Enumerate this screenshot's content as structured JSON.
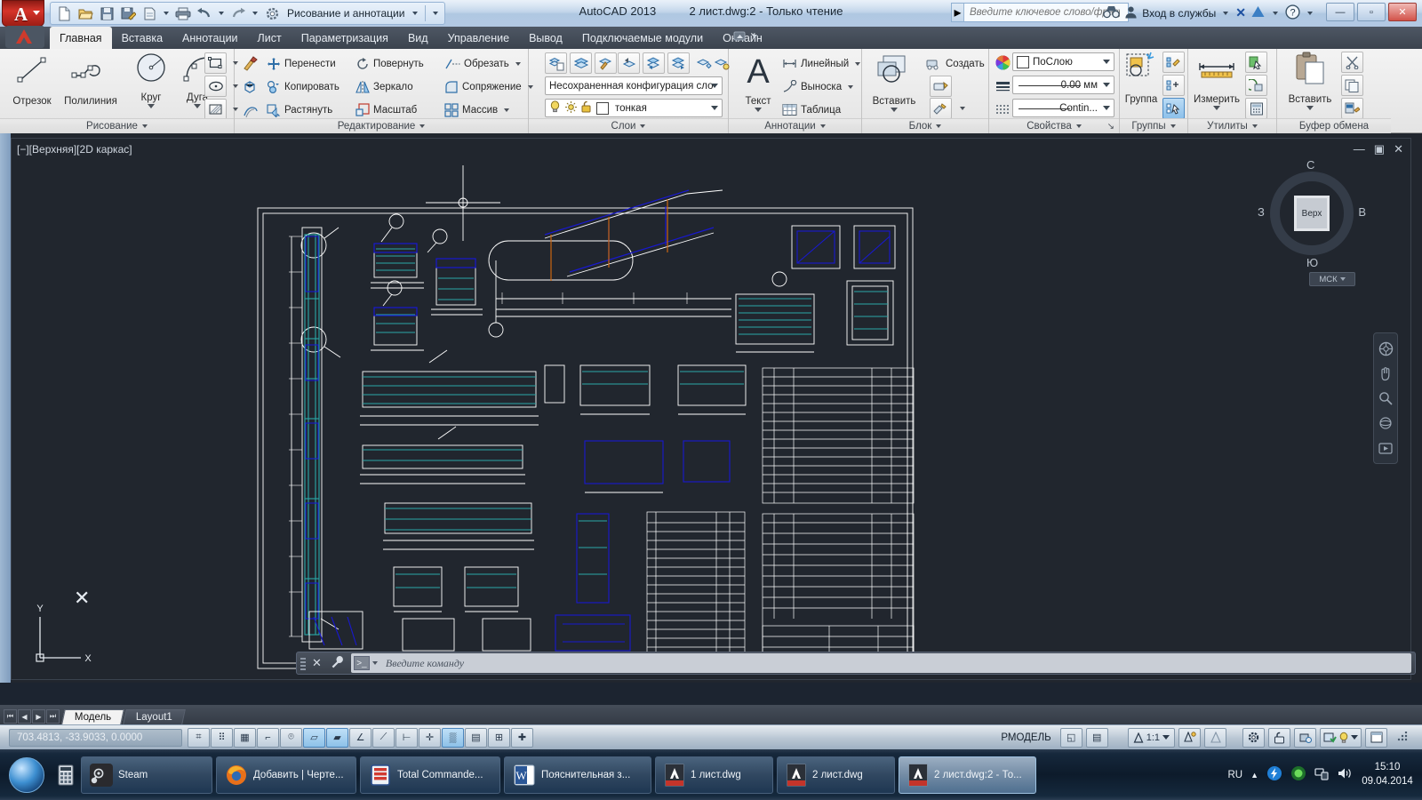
{
  "titlebar": {
    "app_icon": "autocad-logo-icon",
    "quick_access": [
      {
        "name": "new-icon",
        "glyph": "🗋"
      },
      {
        "name": "open-icon",
        "glyph": "🗁"
      },
      {
        "name": "save-icon",
        "glyph": "🖫"
      },
      {
        "name": "save-as-icon",
        "glyph": "🖫"
      },
      {
        "name": "plot-preview-icon",
        "glyph": "🗐"
      },
      {
        "name": "print-icon",
        "glyph": "🖨"
      },
      {
        "name": "undo-icon",
        "glyph": "↶"
      },
      {
        "name": "redo-icon",
        "glyph": "↷"
      }
    ],
    "workspace": "Рисование и аннотации",
    "app_name": "AutoCAD 2013",
    "document": "2 лист.dwg:2 - Только чтение",
    "search_placeholder": "Введите ключевое слово/фразу",
    "signin": "Вход в службы",
    "help_icon": "help-icon",
    "window_buttons": {
      "minimize": "—",
      "maximize": "▫",
      "close": "✕"
    }
  },
  "tabs": [
    {
      "label": "Главная",
      "active": true
    },
    {
      "label": "Вставка",
      "active": false
    },
    {
      "label": "Аннотации",
      "active": false
    },
    {
      "label": "Лист",
      "active": false
    },
    {
      "label": "Параметризация",
      "active": false
    },
    {
      "label": "Вид",
      "active": false
    },
    {
      "label": "Управление",
      "active": false
    },
    {
      "label": "Вывод",
      "active": false
    },
    {
      "label": "Подключаемые модули",
      "active": false
    },
    {
      "label": "Онлайн",
      "active": false
    }
  ],
  "panels": {
    "draw": {
      "title": "Рисование",
      "tools": [
        {
          "label": "Отрезок",
          "icon": "line-icon"
        },
        {
          "label": "Полилиния",
          "icon": "polyline-icon"
        },
        {
          "label": "Круг",
          "icon": "circle-icon",
          "dropdown": true
        },
        {
          "label": "Дуга",
          "icon": "arc-icon",
          "dropdown": true
        }
      ],
      "small_icons": [
        "rectangle-icon",
        "ellipse-icon",
        "hatch-icon"
      ]
    },
    "modify": {
      "title": "Редактирование",
      "items": [
        {
          "label": "Перенести",
          "icon": "move-icon"
        },
        {
          "label": "Повернуть",
          "icon": "rotate-icon"
        },
        {
          "label": "Обрезать",
          "icon": "trim-icon",
          "dropdown": true
        },
        {
          "label": "Копировать",
          "icon": "copy-icon"
        },
        {
          "label": "Зеркало",
          "icon": "mirror-icon"
        },
        {
          "label": "Сопряжение",
          "icon": "fillet-icon",
          "dropdown": true
        },
        {
          "label": "Растянуть",
          "icon": "stretch-icon"
        },
        {
          "label": "Масштаб",
          "icon": "scale-icon"
        },
        {
          "label": "Массив",
          "icon": "array-icon",
          "dropdown": true
        }
      ],
      "side_icons": [
        "match-properties-icon",
        "explode-icon",
        "offset-icon"
      ]
    },
    "layers": {
      "title": "Слои",
      "icons": [
        "layer-properties-icon",
        "layer-state-icon",
        "layer-match-icon",
        "layer-previous-icon",
        "layer-isolate-icon",
        "layer-unisolate-icon",
        "layer-freeze-icon",
        "layer-off-icon"
      ],
      "layer_state": "Несохраненная конфигурация сло",
      "current_layer": "тонкая",
      "layer_toggles": [
        "lightbulb-icon",
        "sun-icon",
        "unlock-icon",
        "color-swatch-icon"
      ]
    },
    "annotation": {
      "title": "Аннотации",
      "big": {
        "label": "Текст",
        "icon": "text-icon",
        "dropdown": true
      },
      "items": [
        {
          "label": "Линейный",
          "icon": "linear-dimension-icon",
          "dropdown": true
        },
        {
          "label": "Выноска",
          "icon": "leader-icon",
          "dropdown": true
        },
        {
          "label": "Таблица",
          "icon": "table-icon"
        }
      ]
    },
    "block": {
      "title": "Блок",
      "big": {
        "label": "Вставить",
        "icon": "insert-block-icon",
        "dropdown": true
      },
      "items": [
        {
          "label": "Создать",
          "icon": "create-block-icon"
        }
      ],
      "side_icons": [
        "edit-attribute-icon",
        "define-attribute-icon"
      ]
    },
    "properties": {
      "title": "Свойства",
      "color": "ПоСлою",
      "lineweight": "0.00 мм",
      "linetype": "Contin...",
      "icons": [
        "color-wheel-icon",
        "lineweight-icon",
        "linetype-icon"
      ]
    },
    "groups": {
      "title": "Группы",
      "big": {
        "label": "Группа",
        "icon": "group-icon"
      },
      "side_icons": [
        "edit-group-icon",
        "add-to-group-icon",
        "group-selection-icon"
      ]
    },
    "utilities": {
      "title": "Утилиты",
      "big": {
        "label": "Измерить",
        "icon": "measure-icon",
        "dropdown": true
      },
      "side_icons": [
        "quick-select-icon",
        "quick-calc-icon",
        "calculator-icon"
      ]
    },
    "clipboard": {
      "title": "Буфер обмена",
      "big": {
        "label": "Вставить",
        "icon": "paste-icon",
        "dropdown": true
      },
      "side_icons": [
        "cut-icon",
        "copy-clip-icon",
        "paste-special-icon"
      ]
    }
  },
  "viewport": {
    "label": "[−][Верхняя][2D каркас]",
    "win_buttons": {
      "minimize": "—",
      "restore": "▣",
      "close": "✕"
    },
    "viewcube": {
      "top": "С",
      "left": "З",
      "right": "В",
      "bottom": "Ю",
      "face": "Верх"
    },
    "ucs_button": "МСК",
    "nav_icons": [
      "steering-wheel-icon",
      "pan-icon",
      "zoom-extents-icon",
      "orbit-icon",
      "showmotion-icon"
    ],
    "ucs_axes": {
      "x": "X",
      "y": "Y"
    },
    "colors": {
      "background": "#21262e",
      "white_lines": "#ffffff",
      "cyan_lines": "#2aa8a8",
      "blue_lines": "#1818d0",
      "orange_lines": "#cc6611",
      "green_lines": "#2a9d62"
    }
  },
  "command_line": {
    "close_icon": "close-icon",
    "settings_icon": "wrench-icon",
    "prompt_icon": "command-prompt-icon",
    "placeholder": "Введите  команду"
  },
  "layout_tabs": {
    "nav": [
      "⏮",
      "◀",
      "▶",
      "⏭"
    ],
    "tabs": [
      {
        "label": "Модель",
        "active": true
      },
      {
        "label": "Layout1",
        "active": false
      }
    ]
  },
  "status_bar": {
    "coordinates": "703.4813, -33.9033, 0.0000",
    "left_toggles": [
      {
        "name": "infer-constraints-toggle",
        "glyph": "⌗",
        "on": false
      },
      {
        "name": "snap-mode-toggle",
        "glyph": "⠿",
        "on": false
      },
      {
        "name": "grid-display-toggle",
        "glyph": "▦",
        "on": false
      },
      {
        "name": "ortho-mode-toggle",
        "glyph": "⌐",
        "on": false
      },
      {
        "name": "polar-tracking-toggle",
        "glyph": "⌾",
        "on": false
      },
      {
        "name": "object-snap-toggle",
        "glyph": "▱",
        "on": true
      },
      {
        "name": "3d-object-snap-toggle",
        "glyph": "▰",
        "on": true
      },
      {
        "name": "object-snap-tracking-toggle",
        "glyph": "∠",
        "on": false
      },
      {
        "name": "ucs-tracking-toggle",
        "glyph": "⟋",
        "on": false
      },
      {
        "name": "dynamic-ucs-toggle",
        "glyph": "⊢",
        "on": false
      },
      {
        "name": "dynamic-input-toggle",
        "glyph": "✛",
        "on": false
      },
      {
        "name": "lineweight-toggle",
        "glyph": "▒",
        "on": true
      },
      {
        "name": "transparency-toggle",
        "glyph": "▤",
        "on": false
      },
      {
        "name": "quick-properties-toggle",
        "glyph": "⊞",
        "on": false
      },
      {
        "name": "selection-cycling-toggle",
        "glyph": "✚",
        "on": false
      }
    ],
    "space_label": "РМОДЕЛЬ",
    "right_icons": [
      {
        "name": "model-space-icon",
        "glyph": "◱"
      },
      {
        "name": "paper-space-icon",
        "glyph": "▤"
      }
    ],
    "annotation_scale": "1:1",
    "scale_icons": [
      "annotation-scale-icon",
      "annotation-visibility-icon",
      "auto-scale-icon"
    ],
    "tray_icons": [
      "workspace-switch-icon",
      "lock-toolbars-icon",
      "hardware-accel-icon",
      "isolate-objects-icon",
      "status-bar-menu-icon",
      "clean-screen-icon"
    ]
  },
  "taskbar": {
    "start_icon": "windows-start-icon",
    "quick_launch": [
      {
        "name": "calculator-icon",
        "glyph": "🖩"
      }
    ],
    "buttons": [
      {
        "label": "Steam",
        "icon": "steam-icon",
        "active": false
      },
      {
        "label": "Добавить | Черте...",
        "icon": "firefox-icon",
        "active": false
      },
      {
        "label": "Total Commande...",
        "icon": "total-commander-icon",
        "active": false
      },
      {
        "label": "Пояснительная з...",
        "icon": "word-icon",
        "active": false
      },
      {
        "label": "1 лист.dwg",
        "icon": "autocad-icon",
        "active": false
      },
      {
        "label": "2 лист.dwg",
        "icon": "autocad-icon",
        "active": false
      },
      {
        "label": "2 лист.dwg:2 - То...",
        "icon": "autocad-icon",
        "active": true
      }
    ],
    "tray": {
      "language": "RU",
      "icons": [
        "show-hidden-icon",
        "flash-icon",
        "antivirus-icon",
        "network-icon",
        "volume-icon"
      ],
      "time": "15:10",
      "date": "09.04.2014"
    }
  }
}
